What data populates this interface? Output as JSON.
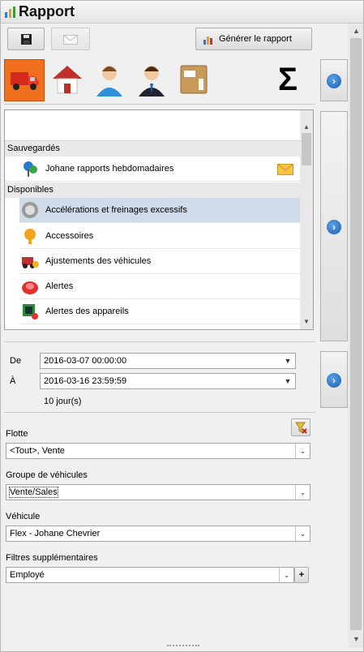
{
  "window": {
    "title": "Rapport"
  },
  "toolbar": {
    "save_icon": "floppy-disk-icon",
    "email_icon": "envelope-icon",
    "generate_label": "Générer le rapport"
  },
  "categories": [
    {
      "icon": "truck-icon",
      "selected": true
    },
    {
      "icon": "house-icon"
    },
    {
      "icon": "person-icon"
    },
    {
      "icon": "businessman-icon"
    },
    {
      "icon": "package-icon"
    },
    {
      "icon": "sigma-icon"
    }
  ],
  "reports": {
    "search_value": "",
    "saved_header": "Sauvegardés",
    "saved": [
      {
        "label": "Johane rapports hebdomadaires",
        "icon": "pin-ab-icon",
        "badge_icon": "envelope-icon"
      }
    ],
    "available_header": "Disponibles",
    "available": [
      {
        "label": "Accélérations et freinages excessifs",
        "icon": "gauge-icon",
        "selected": true
      },
      {
        "label": "Accessoires",
        "icon": "bulb-icon"
      },
      {
        "label": "Ajustements des véhicules",
        "icon": "truck-wrench-icon"
      },
      {
        "label": "Alertes",
        "icon": "siren-icon"
      },
      {
        "label": "Alertes des appareils",
        "icon": "device-alert-icon"
      }
    ]
  },
  "dates": {
    "from_label": "De",
    "from_value": "2016-03-07 00:00:00",
    "to_label": "À",
    "to_value": "2016-03-16 23:59:59",
    "duration": "10 jour(s)"
  },
  "filters": {
    "fleet_label": "Flotte",
    "fleet_value": "<Tout>, Vente",
    "group_label": "Groupe de véhicules",
    "group_value": "Vente/Sales",
    "vehicle_label": "Véhicule",
    "vehicle_value": "Flex - Johane Chevrier",
    "extra_label": "Filtres supplémentaires",
    "extra_value": "Employé"
  },
  "colors": {
    "accent": "#1b5fb0",
    "selected_category": "#f07020"
  }
}
